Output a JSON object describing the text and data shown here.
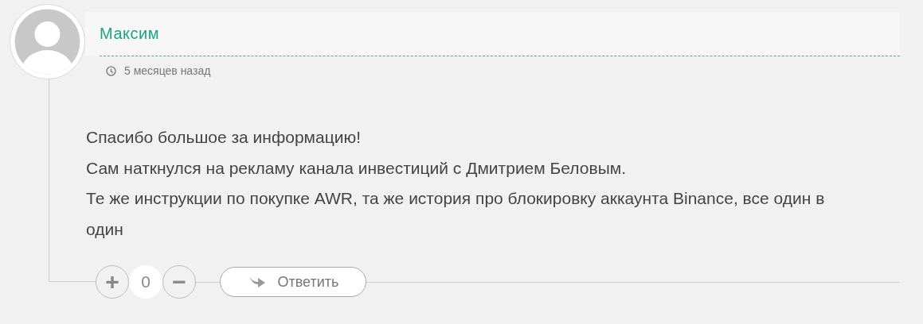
{
  "comment": {
    "author": "Максим",
    "time": "5 месяцев назад",
    "lines": [
      "Спасибо большое за информацию!",
      "Сам наткнулся на рекламу канала инвестиций с Дмитрием Беловым.",
      "Те же инструкции по покупке AWR, та же история про блокировку аккаунта Binance, все один в один"
    ],
    "votes": {
      "plus": "+",
      "count": "0",
      "minus": "−"
    },
    "reply": "Ответить"
  }
}
